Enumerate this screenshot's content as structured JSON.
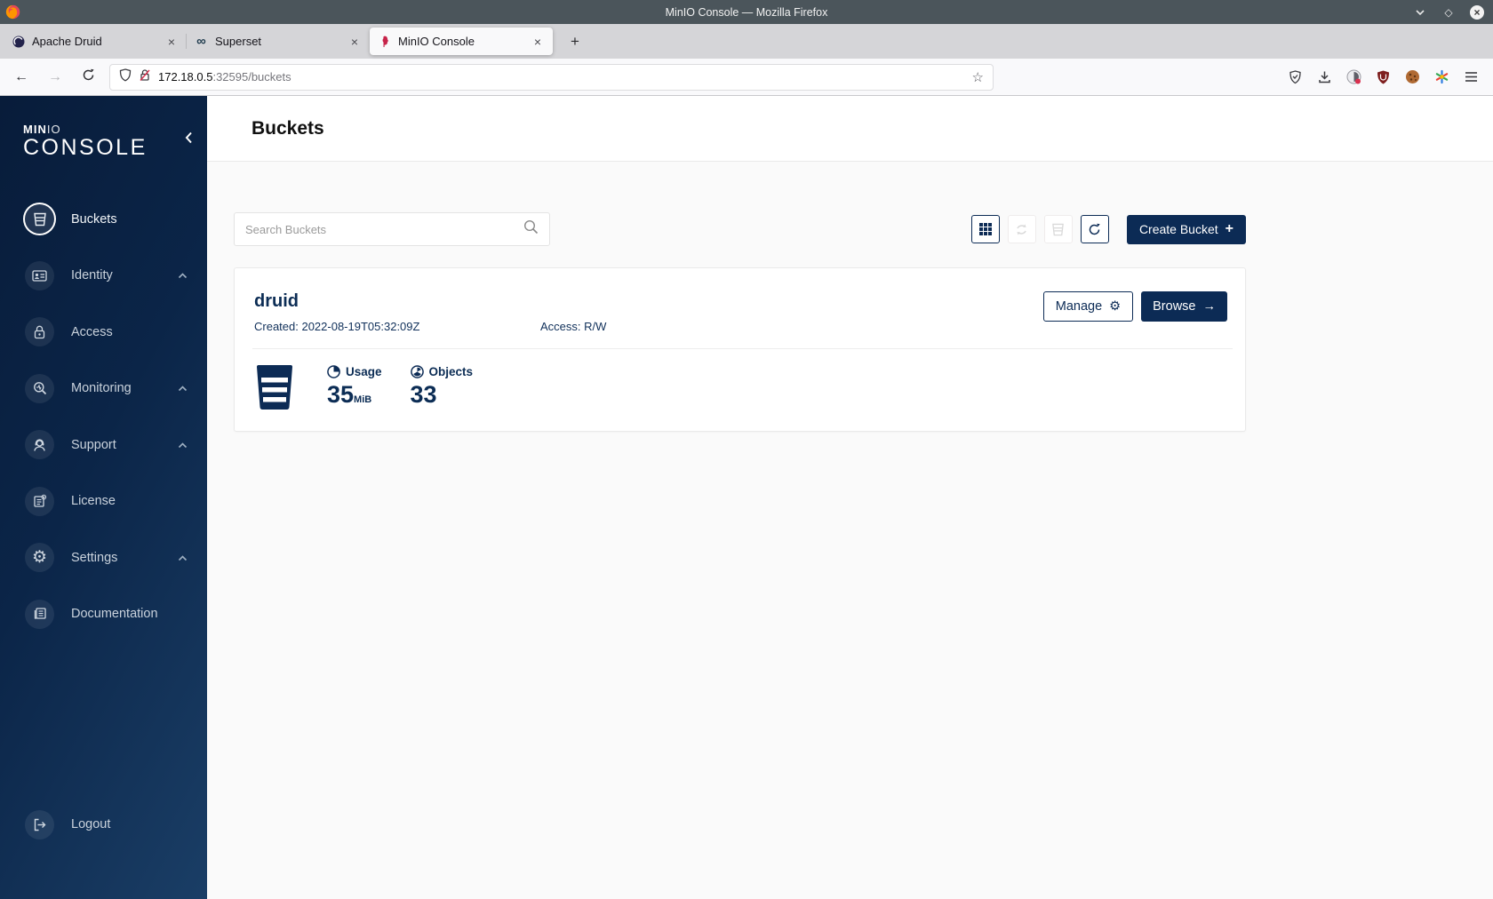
{
  "colors": {
    "accent_navy": "#0c2b55",
    "sidebar_gradient_start": "#081c3a",
    "sidebar_gradient_end": "#1a3e66",
    "titlebar_gray": "#4b555b",
    "page_background": "#fafafa",
    "disabled_gray": "#d9d9d9"
  },
  "icons": {
    "close": "×",
    "star": "☆",
    "plus": "+",
    "arrow_right": "→",
    "back_arrow": "←",
    "forward_arrow": "→",
    "gear": "⚙",
    "infinity": "∞",
    "maximize_diamond": "◇"
  },
  "titlebar": {
    "title": "MinIO Console — Mozilla Firefox"
  },
  "tabbar": {
    "tabs": [
      {
        "label": "Apache Druid"
      },
      {
        "label": "Superset"
      },
      {
        "label": "MinIO Console"
      }
    ],
    "active_tab_index": 2
  },
  "navbar": {
    "url_host": "172.18.0.5",
    "url_path": ":32595/buckets"
  },
  "sidebar": {
    "logo_bold": "MIN",
    "logo_thin": "IO",
    "logo_line2": "CONSOLE",
    "items": [
      {
        "label": "Buckets",
        "active": true
      },
      {
        "label": "Identity",
        "expandable": true
      },
      {
        "label": "Access"
      },
      {
        "label": "Monitoring",
        "expandable": true
      },
      {
        "label": "Support",
        "expandable": true
      },
      {
        "label": "License"
      },
      {
        "label": "Settings",
        "expandable": true
      },
      {
        "label": "Documentation"
      }
    ],
    "logout_label": "Logout"
  },
  "page": {
    "title": "Buckets",
    "search_placeholder": "Search Buckets",
    "create_button_label": "Create Bucket"
  },
  "bucket": {
    "name": "druid",
    "created": "Created: 2022-08-19T05:32:09Z",
    "access": "Access: R/W",
    "manage_label": "Manage",
    "browse_label": "Browse",
    "usage_label": "Usage",
    "usage_value": "35",
    "usage_unit": "MiB",
    "objects_label": "Objects",
    "objects_value": "33"
  }
}
